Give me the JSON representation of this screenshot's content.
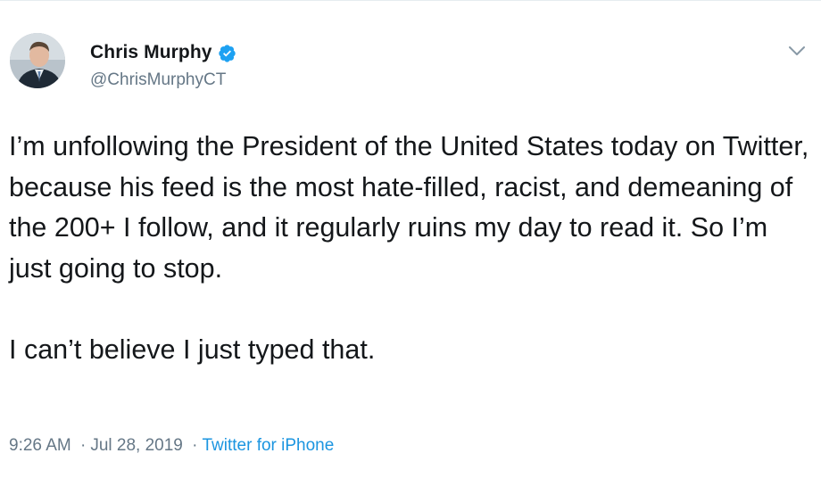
{
  "tweet": {
    "author": {
      "display_name": "Chris Murphy",
      "handle": "@ChrisMurphyCT",
      "verified": true,
      "avatar_icon": "person-photo-avatar"
    },
    "text_paragraph_1": "I’m unfollowing the President of the United States today on Twitter, because his feed is the most hate-filled, racist, and demeaning of the 200+ I follow, and it regularly ruins my day to read it. So I’m just going to stop.",
    "text_paragraph_2": "I can’t believe I just typed that.",
    "time": "9:26 AM",
    "date": "Jul 28, 2019",
    "separator": "·",
    "source": "Twitter for iPhone"
  },
  "colors": {
    "text": "#14171a",
    "secondary": "#657786",
    "link": "#1b95e0",
    "verified": "#1da1f2"
  },
  "icons": {
    "verified": "verified-badge-icon",
    "menu": "chevron-down-icon"
  }
}
